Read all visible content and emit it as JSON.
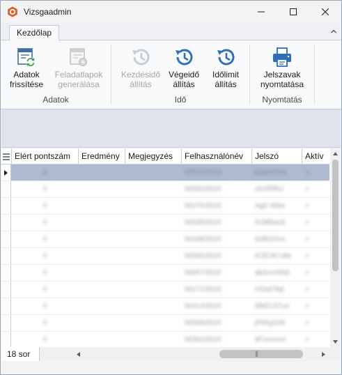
{
  "window": {
    "title": "Vizsgaadmin",
    "accent": "#e05a2b"
  },
  "ribbon": {
    "tabs": [
      {
        "label": "Kezdőlap",
        "active": true
      }
    ],
    "groups": [
      {
        "label": "Adatok",
        "buttons": [
          {
            "line1": "Adatok",
            "line2": "frissítése",
            "icon": "refresh-table-icon",
            "enabled": true
          },
          {
            "line1": "Feladatlapok",
            "line2": "generálása",
            "icon": "form-gear-icon",
            "enabled": false
          }
        ]
      },
      {
        "label": "Idő",
        "buttons": [
          {
            "line1": "Kezdésidő",
            "line2": "állítás",
            "icon": "clock-history-icon",
            "enabled": false
          },
          {
            "line1": "Végeidő",
            "line2": "állítás",
            "icon": "clock-history-icon",
            "enabled": true
          },
          {
            "line1": "Időlimit",
            "line2": "állítás",
            "icon": "clock-history-icon",
            "enabled": true
          }
        ]
      },
      {
        "label": "Nyomtatás",
        "buttons": [
          {
            "line1": "Jelszavak",
            "line2": "nyomtatása",
            "icon": "printer-icon",
            "enabled": true
          }
        ]
      }
    ]
  },
  "grid": {
    "columns": [
      "Elért pontszám",
      "Eredmény",
      "Megjegyzés",
      "Felhasználónév",
      "Jelszó",
      "Aktív"
    ],
    "rows": [
      {
        "pontszam": "0",
        "felhasznalo": "00023/2023",
        "jelszo": "bZpw7mK",
        "aktiv": ">",
        "selected": true
      },
      {
        "pontszam": "0",
        "felhasznalo": "00332/2024",
        "jelszo": "eKXRfNJ",
        "aktiv": ">",
        "selected": false
      },
      {
        "pontszam": "0",
        "felhasznalo": "00276/2023",
        "jelszo": "AgK-Ndar",
        "aktiv": ">",
        "selected": false
      },
      {
        "pontszam": "0",
        "felhasznalo": "00335/2024",
        "jelszo": "RJ9f6wnk",
        "aktiv": ">",
        "selected": false
      },
      {
        "pontszam": "0",
        "felhasznalo": "00438/2024",
        "jelszo": "6xBO2ms",
        "aktiv": ">",
        "selected": false
      },
      {
        "pontszam": "0",
        "felhasznalo": "00345/2024",
        "jelszo": "tC5C9Cv8a",
        "aktiv": ">",
        "selected": false
      },
      {
        "pontszam": "0",
        "felhasznalo": "00067/2022",
        "jelszo": "akAmnhNd",
        "aktiv": ">",
        "selected": false
      },
      {
        "pontszam": "0",
        "felhasznalo": "00271/2023",
        "jelszo": "H2w67bjt",
        "aktiv": ">",
        "selected": false
      },
      {
        "pontszam": "0",
        "felhasznalo": "00414/2024",
        "jelszo": "MkEC5Tue",
        "aktiv": ">",
        "selected": false
      },
      {
        "pontszam": "0",
        "felhasznalo": "00349/2024",
        "jelszo": "jFhKgGW",
        "aktiv": ">",
        "selected": false
      },
      {
        "pontszam": "0",
        "felhasznalo": "00362/2024",
        "jelszo": "8Fccnne4",
        "aktiv": ">",
        "selected": false
      }
    ]
  },
  "status": {
    "row_count": "18 sor"
  }
}
